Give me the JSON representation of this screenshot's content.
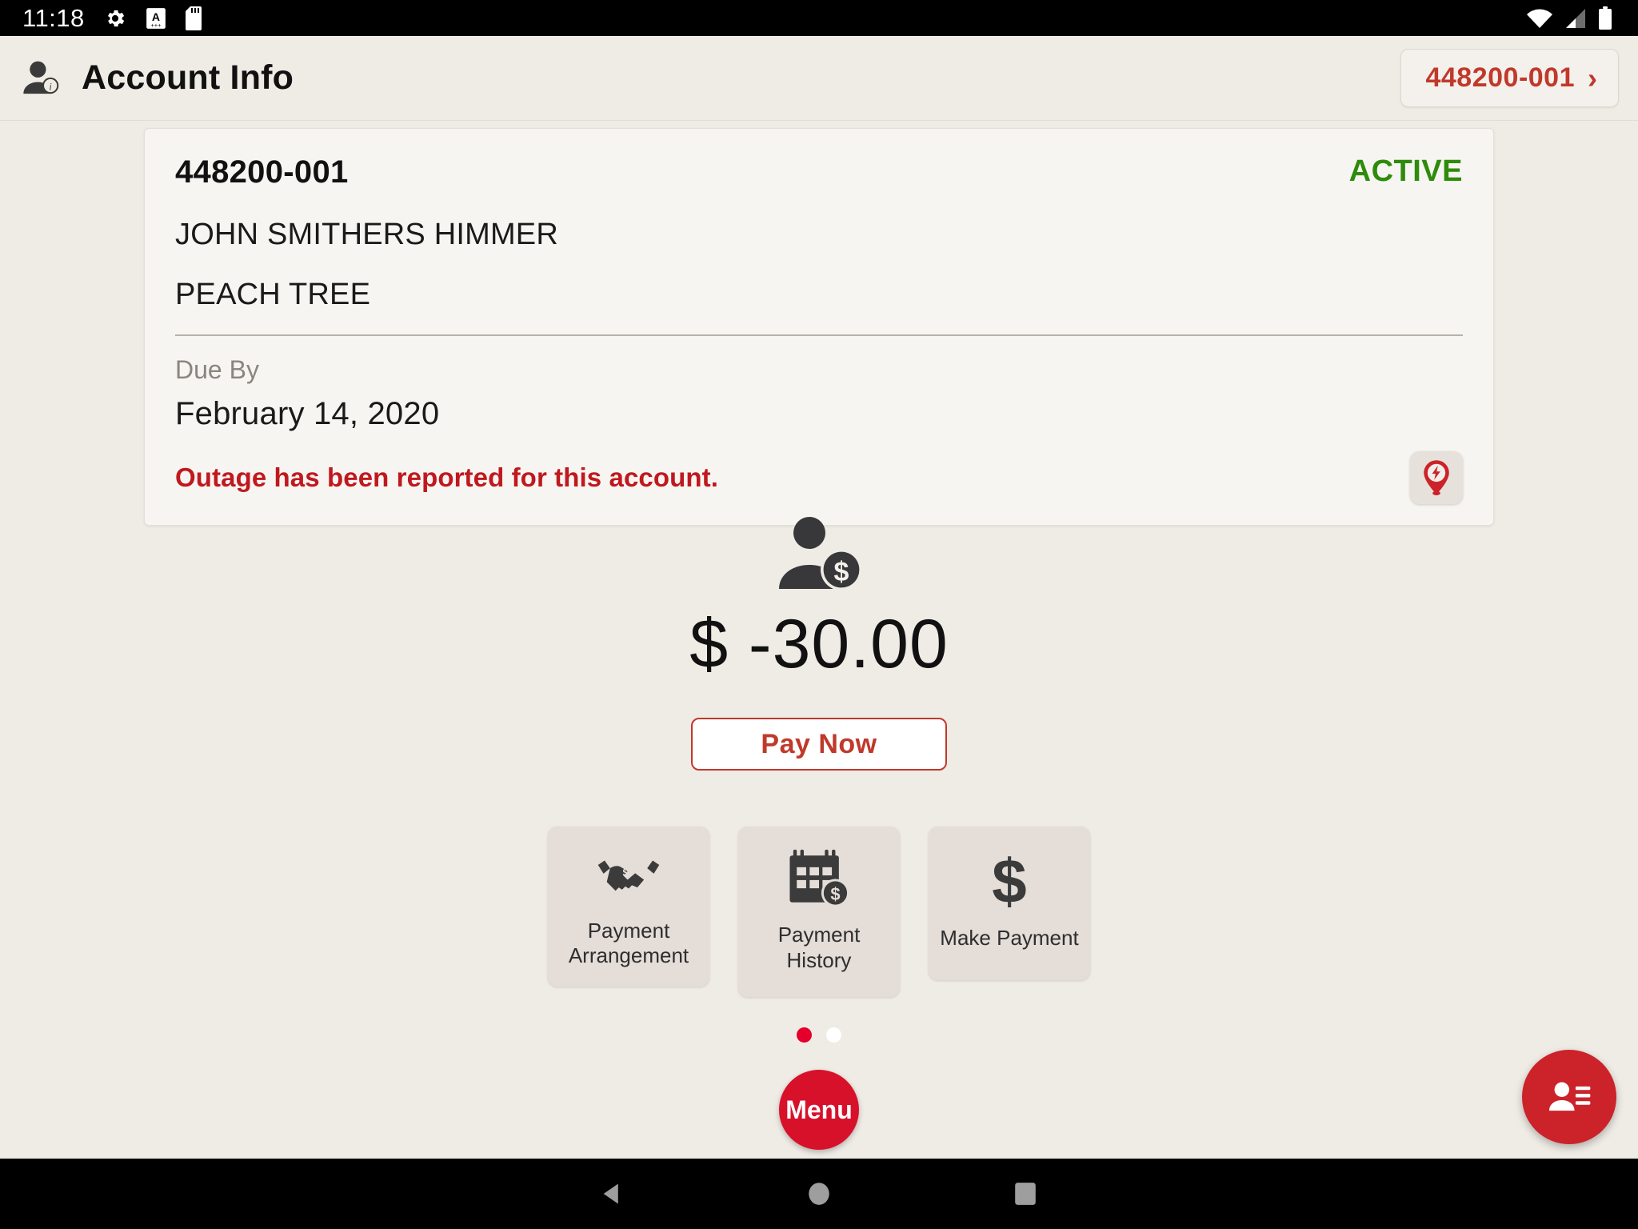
{
  "statusbar": {
    "clock": "11:18",
    "left_icons": [
      "gear-icon",
      "a-font-icon",
      "sd-card-icon"
    ],
    "right_icons": [
      "wifi-icon",
      "cell-signal-icon",
      "battery-icon"
    ]
  },
  "header": {
    "icon": "account-info-icon",
    "title": "Account Info",
    "account_chip": {
      "label": "448200-001",
      "chevron": "›"
    }
  },
  "account_card": {
    "account_number": "448200-001",
    "status": "ACTIVE",
    "status_color": "#2e8b0c",
    "customer_name": "JOHN SMITHERS HIMMER",
    "service_address": "PEACH TREE",
    "due_by_label": "Due By",
    "due_by_date": "February 14, 2020",
    "outage_message": "Outage has been reported for this account.",
    "outage_message_color": "#c0181f",
    "outage_button_icon": "outage-pin-icon"
  },
  "balance": {
    "icon": "customer-balance-icon",
    "amount": "$ -30.00",
    "pay_now_label": "Pay Now",
    "accent_color": "#c0392b"
  },
  "tiles": [
    {
      "icon": "handshake-icon",
      "label_line1": "Payment",
      "label_line2": "Arrangement"
    },
    {
      "icon": "calendar-dollar-icon",
      "label_line1": "Payment",
      "label_line2": "History"
    },
    {
      "icon": "dollar-sign-icon",
      "label_line1": "Make Payment",
      "label_line2": ""
    }
  ],
  "pager": {
    "total": 2,
    "active_index": 0,
    "active_color": "#e4002b",
    "inactive_color": "#ffffff"
  },
  "menu_fab": {
    "label": "Menu",
    "color": "#d8112b"
  },
  "contact_fab": {
    "icon": "contact-card-icon",
    "color": "#cc2229"
  },
  "navbar": {
    "back_icon": "back-triangle-icon",
    "home_icon": "home-circle-icon",
    "recents_icon": "recents-square-icon"
  }
}
